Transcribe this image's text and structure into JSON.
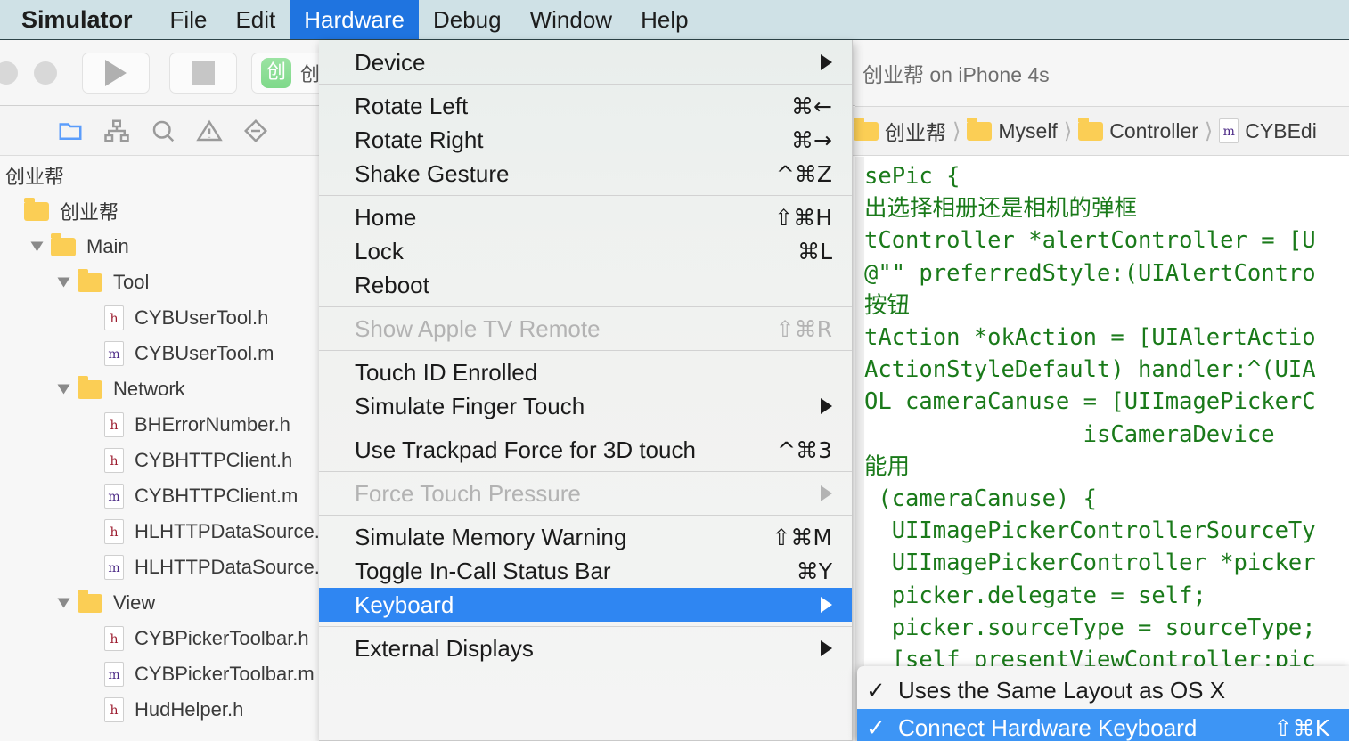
{
  "menubar": {
    "items": [
      {
        "label": "Simulator",
        "state": "app"
      },
      {
        "label": "File",
        "state": "normal"
      },
      {
        "label": "Edit",
        "state": "normal"
      },
      {
        "label": "Hardware",
        "state": "open"
      },
      {
        "label": "Debug",
        "state": "normal"
      },
      {
        "label": "Window",
        "state": "normal"
      },
      {
        "label": "Help",
        "state": "normal"
      }
    ]
  },
  "hardware_menu": {
    "items": [
      {
        "label": "Device",
        "shortcut": "",
        "submenu": true,
        "enabled": true,
        "selected": false
      },
      {
        "label": "Rotate Left",
        "shortcut": "⌘←",
        "submenu": false,
        "enabled": true,
        "selected": false
      },
      {
        "label": "Rotate Right",
        "shortcut": "⌘→",
        "submenu": false,
        "enabled": true,
        "selected": false
      },
      {
        "label": "Shake Gesture",
        "shortcut": "^⌘Z",
        "submenu": false,
        "enabled": true,
        "selected": false
      },
      {
        "label": "Home",
        "shortcut": "⇧⌘H",
        "submenu": false,
        "enabled": true,
        "selected": false
      },
      {
        "label": "Lock",
        "shortcut": "⌘L",
        "submenu": false,
        "enabled": true,
        "selected": false
      },
      {
        "label": "Reboot",
        "shortcut": "",
        "submenu": false,
        "enabled": true,
        "selected": false
      },
      {
        "label": "Show Apple TV Remote",
        "shortcut": "⇧⌘R",
        "submenu": false,
        "enabled": false,
        "selected": false
      },
      {
        "label": "Touch ID Enrolled",
        "shortcut": "",
        "submenu": false,
        "enabled": true,
        "selected": false
      },
      {
        "label": "Simulate Finger Touch",
        "shortcut": "",
        "submenu": true,
        "enabled": true,
        "selected": false
      },
      {
        "label": "Use Trackpad Force for 3D touch",
        "shortcut": "^⌘3",
        "submenu": false,
        "enabled": true,
        "selected": false
      },
      {
        "label": "Force Touch Pressure",
        "shortcut": "",
        "submenu": true,
        "enabled": false,
        "selected": false
      },
      {
        "label": "Simulate Memory Warning",
        "shortcut": "⇧⌘M",
        "submenu": false,
        "enabled": true,
        "selected": false
      },
      {
        "label": "Toggle In-Call Status Bar",
        "shortcut": "⌘Y",
        "submenu": false,
        "enabled": true,
        "selected": false
      },
      {
        "label": "Keyboard",
        "shortcut": "",
        "submenu": true,
        "enabled": true,
        "selected": true
      },
      {
        "label": "External Displays",
        "shortcut": "",
        "submenu": true,
        "enabled": true,
        "selected": false
      }
    ]
  },
  "keyboard_submenu": {
    "items": [
      {
        "check": "✓",
        "label": "Uses the Same Layout as OS X",
        "shortcut": "",
        "selected": false
      },
      {
        "check": "✓",
        "label": "Connect Hardware Keyboard",
        "shortcut": "⇧⌘K",
        "selected": true
      }
    ]
  },
  "xcode": {
    "toolbar": {
      "scheme_icon_glyph": "创",
      "scheme_label": "创业帮"
    },
    "navigator_filters": [
      "folder-icon",
      "hierarchy-icon",
      "search-icon",
      "warning-icon",
      "minus-diamond-icon"
    ],
    "jump_bar": {
      "run_destination": "创业帮 on iPhone 4s"
    },
    "breadcrumb": {
      "items": [
        {
          "type": "folder",
          "label": "创业帮"
        },
        {
          "type": "folder",
          "label": "Myself"
        },
        {
          "type": "folder",
          "label": "Controller"
        },
        {
          "type": "file-m",
          "label": "CYBEdi"
        }
      ]
    },
    "navigator": {
      "root": "创业帮",
      "rows": [
        {
          "indent": 0,
          "disclosure": false,
          "icon": "folder",
          "label": "创业帮"
        },
        {
          "indent": 1,
          "disclosure": true,
          "icon": "folder",
          "label": "Main"
        },
        {
          "indent": 2,
          "disclosure": true,
          "icon": "folder",
          "label": "Tool"
        },
        {
          "indent": 3,
          "disclosure": false,
          "icon": "file-h",
          "label": "CYBUserTool.h"
        },
        {
          "indent": 3,
          "disclosure": false,
          "icon": "file-m",
          "label": "CYBUserTool.m"
        },
        {
          "indent": 2,
          "disclosure": true,
          "icon": "folder",
          "label": "Network"
        },
        {
          "indent": 3,
          "disclosure": false,
          "icon": "file-h",
          "label": "BHErrorNumber.h"
        },
        {
          "indent": 3,
          "disclosure": false,
          "icon": "file-h",
          "label": "CYBHTTPClient.h"
        },
        {
          "indent": 3,
          "disclosure": false,
          "icon": "file-m",
          "label": "CYBHTTPClient.m"
        },
        {
          "indent": 3,
          "disclosure": false,
          "icon": "file-h",
          "label": "HLHTTPDataSource.h"
        },
        {
          "indent": 3,
          "disclosure": false,
          "icon": "file-m",
          "label": "HLHTTPDataSource.m"
        },
        {
          "indent": 2,
          "disclosure": true,
          "icon": "folder",
          "label": "View"
        },
        {
          "indent": 3,
          "disclosure": false,
          "icon": "file-h",
          "label": "CYBPickerToolbar.h"
        },
        {
          "indent": 3,
          "disclosure": false,
          "icon": "file-m",
          "label": "CYBPickerToolbar.m"
        },
        {
          "indent": 3,
          "disclosure": false,
          "icon": "file-h",
          "label": "HudHelper.h"
        }
      ]
    },
    "editor": {
      "code": "sePic {\n出选择相册还是相机的弹框\ntController *alertController = [U\n@\"\" preferredStyle:(UIAlertContro\n按钮\ntAction *okAction = [UIAlertActio\nActionStyleDefault) handler:^(UIA\nOL cameraCanuse = [UIImagePickerC\n                isCameraDevice\n能用\n (cameraCanuse) {\n  UIImagePickerControllerSourceTy\n  UIImagePickerController *picker\n  picker.delegate = self;\n  picker.sourceType = sourceType;\n  [self presentViewController:pic"
    }
  },
  "colors": {
    "menubar_bg": "#cfe1e6",
    "menu_highlight": "#1f74e0",
    "submenu_highlight": "#3d95f5",
    "menu_selected": "#2f86f2",
    "code_green": "#1a7a1a",
    "folder_yellow": "#fbce55"
  }
}
